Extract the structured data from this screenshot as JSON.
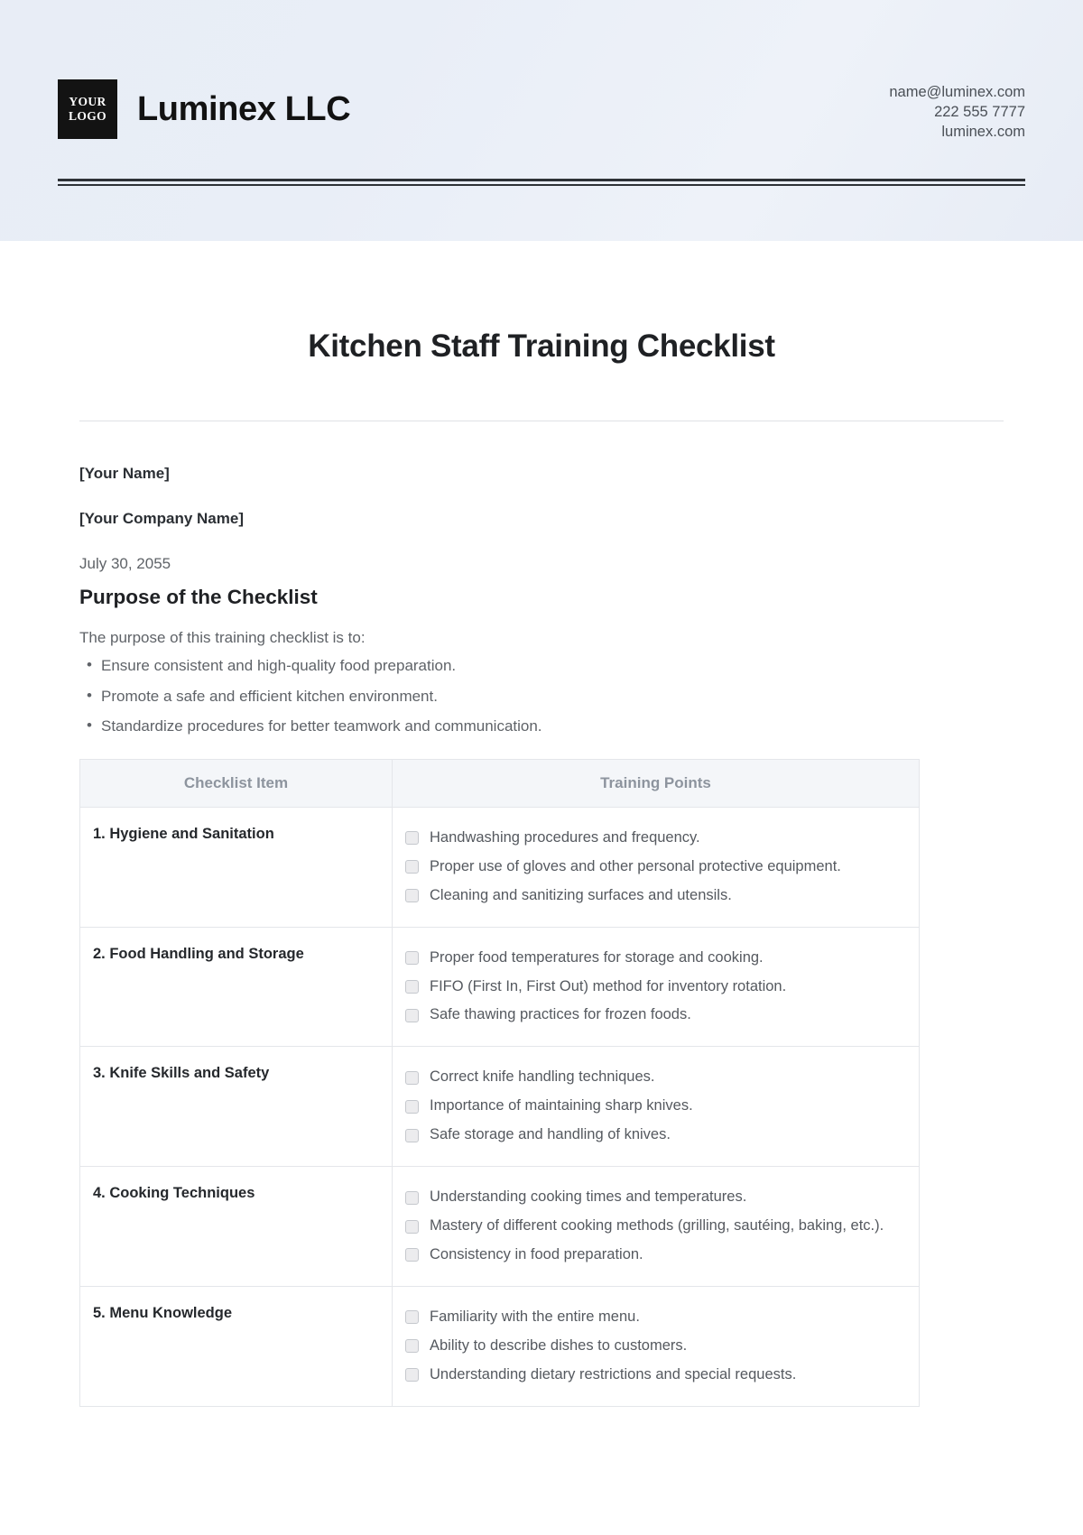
{
  "header": {
    "logo_line1": "YOUR",
    "logo_line2": "LOGO",
    "company": "Luminex LLC",
    "email": "name@luminex.com",
    "phone": "222 555 7777",
    "website": "luminex.com"
  },
  "document": {
    "title": "Kitchen Staff Training Checklist",
    "your_name": "[Your Name]",
    "your_company": "[Your Company Name]",
    "date": "July 30, 2055",
    "section_title": "Purpose of the Checklist",
    "lead": "The purpose of this training checklist is to:",
    "bullets": [
      "Ensure consistent and high-quality food preparation.",
      "Promote a safe and efficient kitchen environment.",
      "Standardize procedures for better teamwork and communication."
    ]
  },
  "table": {
    "headers": [
      "Checklist Item",
      "Training Points"
    ],
    "rows": [
      {
        "item": "1. Hygiene and Sanitation",
        "points": [
          "Handwashing procedures and frequency.",
          "Proper use of gloves and other personal protective equipment.",
          "Cleaning and sanitizing surfaces and utensils."
        ]
      },
      {
        "item": "2. Food Handling and Storage",
        "points": [
          "Proper food temperatures for storage and cooking.",
          "FIFO (First In, First Out) method for inventory rotation.",
          "Safe thawing practices for frozen foods."
        ]
      },
      {
        "item": "3. Knife Skills and Safety",
        "points": [
          "Correct knife handling techniques.",
          "Importance of maintaining sharp knives.",
          "Safe storage and handling of knives."
        ]
      },
      {
        "item": "4. Cooking Techniques",
        "points": [
          "Understanding cooking times and temperatures.",
          "Mastery of different cooking methods (grilling, sautéing, baking, etc.).",
          "Consistency in food preparation."
        ]
      },
      {
        "item": "5. Menu Knowledge",
        "points": [
          "Familiarity with the entire menu.",
          "Ability to describe dishes to customers.",
          "Understanding dietary restrictions and special requests."
        ]
      }
    ]
  },
  "colors": {
    "header_band": "#e9eef7",
    "logo_bg": "#131313",
    "table_header_bg": "#f4f6f9",
    "table_header_text": "#8d949e",
    "border": "#e4e6ea"
  }
}
